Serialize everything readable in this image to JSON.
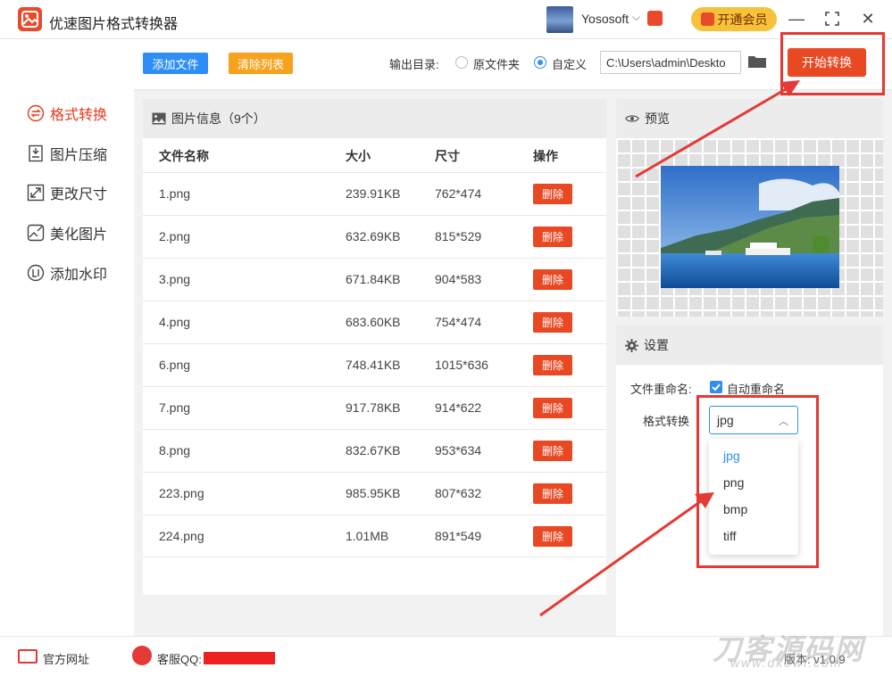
{
  "app": {
    "title": "优速图片格式转换器",
    "user_name": "Yososoft",
    "vip_label": "开通会员"
  },
  "sidebar": {
    "items": [
      {
        "label": "格式转换",
        "icon": "format-convert-icon",
        "active": true
      },
      {
        "label": "图片压缩",
        "icon": "compress-icon",
        "active": false
      },
      {
        "label": "更改尺寸",
        "icon": "resize-icon",
        "active": false
      },
      {
        "label": "美化图片",
        "icon": "beautify-icon",
        "active": false
      },
      {
        "label": "添加水印",
        "icon": "watermark-icon",
        "active": false
      }
    ]
  },
  "toolbar": {
    "add_label": "添加文件",
    "clear_label": "清除列表",
    "output_label": "输出目录:",
    "radio_original": "原文件夹",
    "radio_custom": "自定义",
    "path_value": "C:\\Users\\admin\\Deskto",
    "start_label": "开始转换"
  },
  "file_panel": {
    "title": "图片信息（9个）",
    "columns": [
      "文件名称",
      "大小",
      "尺寸",
      "操作"
    ],
    "delete_label": "删除",
    "rows": [
      {
        "name": "1.png",
        "size": "239.91KB",
        "dims": "762*474"
      },
      {
        "name": "2.png",
        "size": "632.69KB",
        "dims": "815*529"
      },
      {
        "name": "3.png",
        "size": "671.84KB",
        "dims": "904*583"
      },
      {
        "name": "4.png",
        "size": "683.60KB",
        "dims": "754*474"
      },
      {
        "name": "6.png",
        "size": "748.41KB",
        "dims": "1015*636"
      },
      {
        "name": "7.png",
        "size": "917.78KB",
        "dims": "914*622"
      },
      {
        "name": "8.png",
        "size": "832.67KB",
        "dims": "953*634"
      },
      {
        "name": "223.png",
        "size": "985.95KB",
        "dims": "807*632"
      },
      {
        "name": "224.png",
        "size": "1.01MB",
        "dims": "891*549"
      }
    ]
  },
  "preview": {
    "title": "预览"
  },
  "settings": {
    "title": "设置",
    "rename_label": "文件重命名:",
    "rename_value": "自动重命名",
    "format_label": "格式转换",
    "format_value": "jpg",
    "options": [
      "jpg",
      "png",
      "bmp",
      "tiff"
    ]
  },
  "status": {
    "site_label": "官方网址",
    "qq_label": "客服QQ:",
    "version": "版本: v1.0.9"
  },
  "watermark": {
    "main": "刀客源码网",
    "sub": "www.dkewl.com"
  },
  "colors": {
    "accent": "#e84822",
    "blue": "#2f8ef5",
    "orange": "#f7a21d",
    "annotation": "#e53935"
  }
}
